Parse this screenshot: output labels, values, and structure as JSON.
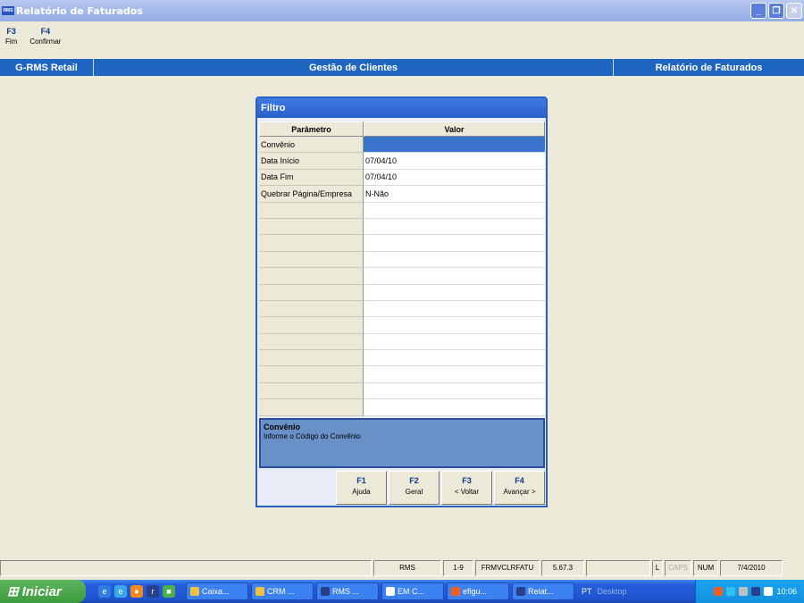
{
  "window": {
    "title": "Relatório de Faturados",
    "logo_text": "RMS"
  },
  "fkeys": [
    {
      "key": "F3",
      "label": "Fim"
    },
    {
      "key": "F4",
      "label": "Confirmar"
    }
  ],
  "header": {
    "left": "G-RMS Retail",
    "center": "Gestão de Clientes",
    "right": "Relatório de Faturados"
  },
  "dialog": {
    "title": "Filtro",
    "columns": {
      "param": "Parâmetro",
      "value": "Valor"
    },
    "rows": [
      {
        "param": "Convênio",
        "value": ""
      },
      {
        "param": "Data Início",
        "value": "07/04/10"
      },
      {
        "param": "Data Fim",
        "value": "07/04/10"
      },
      {
        "param": "Quebrar Página/Empresa",
        "value": "N-Não"
      }
    ],
    "help": {
      "title": "Convênio",
      "text": "Informe o Código do Convênio"
    },
    "buttons": [
      {
        "key": "F1",
        "label": "Ajuda"
      },
      {
        "key": "F2",
        "label": "Geral"
      },
      {
        "key": "F3",
        "label": "< Voltar"
      },
      {
        "key": "F4",
        "label": "Avançar >"
      }
    ]
  },
  "statusbar": {
    "app": "RMS",
    "range": "1-9",
    "form": "FRMVCLRFATU",
    "version": "5.67.3",
    "l": "L",
    "caps": "CAPS",
    "num": "NUM",
    "date": "7/4/2010"
  },
  "taskbar": {
    "start": "Iniciar",
    "tasks": [
      "Caixa...",
      "CRM ...",
      "RMS ...",
      "EM C...",
      "efigu...",
      "Relat..."
    ],
    "lang": "PT",
    "desktop": "Desktop",
    "clock": "10:06"
  },
  "colors": {
    "band": "#1f66c2",
    "selected": "#3b74cc",
    "help": "#6a90c8"
  }
}
